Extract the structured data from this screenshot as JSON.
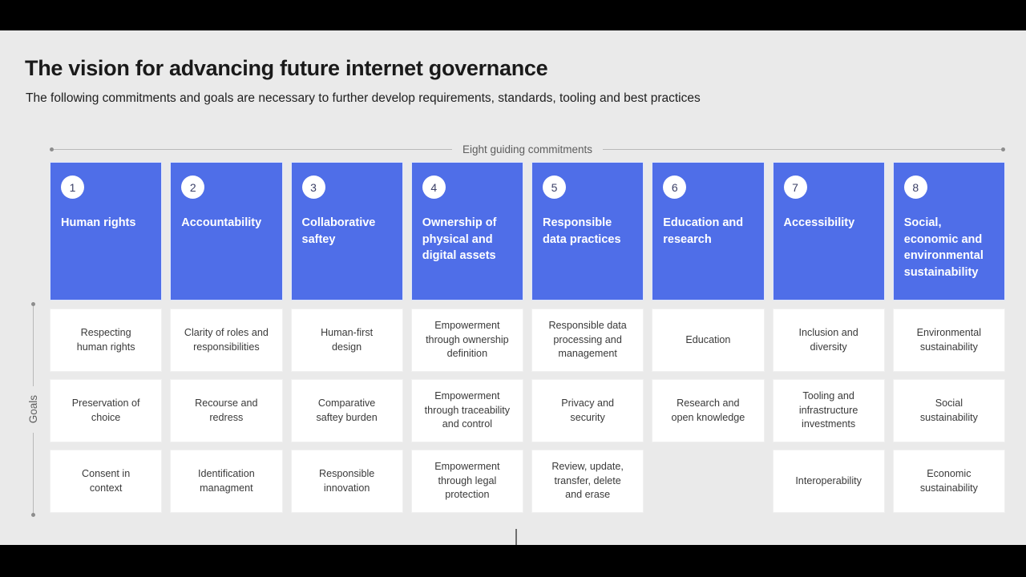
{
  "slide": {
    "title": "The vision for advancing future internet governance",
    "subtitle": "The following commitments and goals are necessary to further develop requirements, standards, tooling and best practices",
    "background_color": "#eaeaea",
    "accent_color": "#4f6ee8"
  },
  "axes": {
    "top_label": "Eight guiding commitments",
    "left_label": "Goals"
  },
  "columns": [
    {
      "number": "1",
      "commitment": "Human rights",
      "goals": [
        "Respecting\nhuman rights",
        "Preservation of\nchoice",
        "Consent in\ncontext"
      ]
    },
    {
      "number": "2",
      "commitment": "Accountability",
      "goals": [
        "Clarity of roles and\nresponsibilities",
        "Recourse and\nredress",
        "Identification\nmanagment"
      ]
    },
    {
      "number": "3",
      "commitment": "Collaborative saftey",
      "goals": [
        "Human-first\ndesign",
        "Comparative\nsaftey burden",
        "Responsible\ninnovation"
      ]
    },
    {
      "number": "4",
      "commitment": "Ownership of physical and digital assets",
      "goals": [
        "Empowerment\nthrough ownership\ndefinition",
        "Empowerment\nthrough traceability\nand control",
        "Empowerment\nthrough legal\nprotection"
      ]
    },
    {
      "number": "5",
      "commitment": "Responsible data practices",
      "goals": [
        "Responsible data\nprocessing and\nmanagement",
        "Privacy and\nsecurity",
        "Review, update,\ntransfer, delete\nand erase"
      ]
    },
    {
      "number": "6",
      "commitment": "Education and research",
      "goals": [
        "Education",
        "Research and\nopen knowledge",
        ""
      ]
    },
    {
      "number": "7",
      "commitment": "Accessibility",
      "goals": [
        "Inclusion and\ndiversity",
        "Tooling and\ninfrastructure\ninvestments",
        "Interoperability"
      ]
    },
    {
      "number": "8",
      "commitment": "Social, economic and environmental sustainability",
      "goals": [
        "Environmental\nsustainability",
        "Social\nsustainability",
        "Economic\nsustainability"
      ]
    }
  ]
}
